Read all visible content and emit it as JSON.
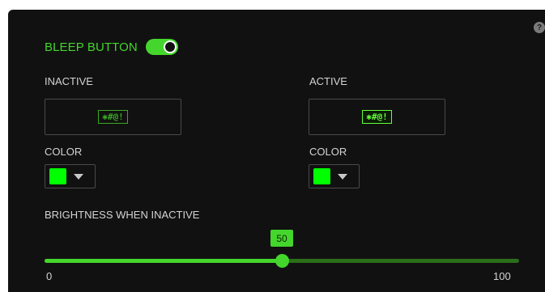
{
  "help": {
    "icon": "question-circle-icon",
    "glyph": "?"
  },
  "bleep": {
    "label": "BLEEP BUTTON",
    "enabled": true
  },
  "inactive": {
    "label": "INACTIVE",
    "preview_text": "✱#@!",
    "color_label": "COLOR",
    "color": "#00ff00"
  },
  "active": {
    "label": "ACTIVE",
    "preview_text": "✱#@!",
    "color_label": "COLOR",
    "color": "#00ff00"
  },
  "brightness": {
    "label": "BRIGHTNESS WHEN INACTIVE",
    "value": 50,
    "value_text": "50",
    "min": 0,
    "max": 100,
    "min_text": "0",
    "max_text": "100"
  },
  "colors": {
    "accent": "#44d62c",
    "track": "#2a6e1a",
    "panel": "#111111"
  }
}
